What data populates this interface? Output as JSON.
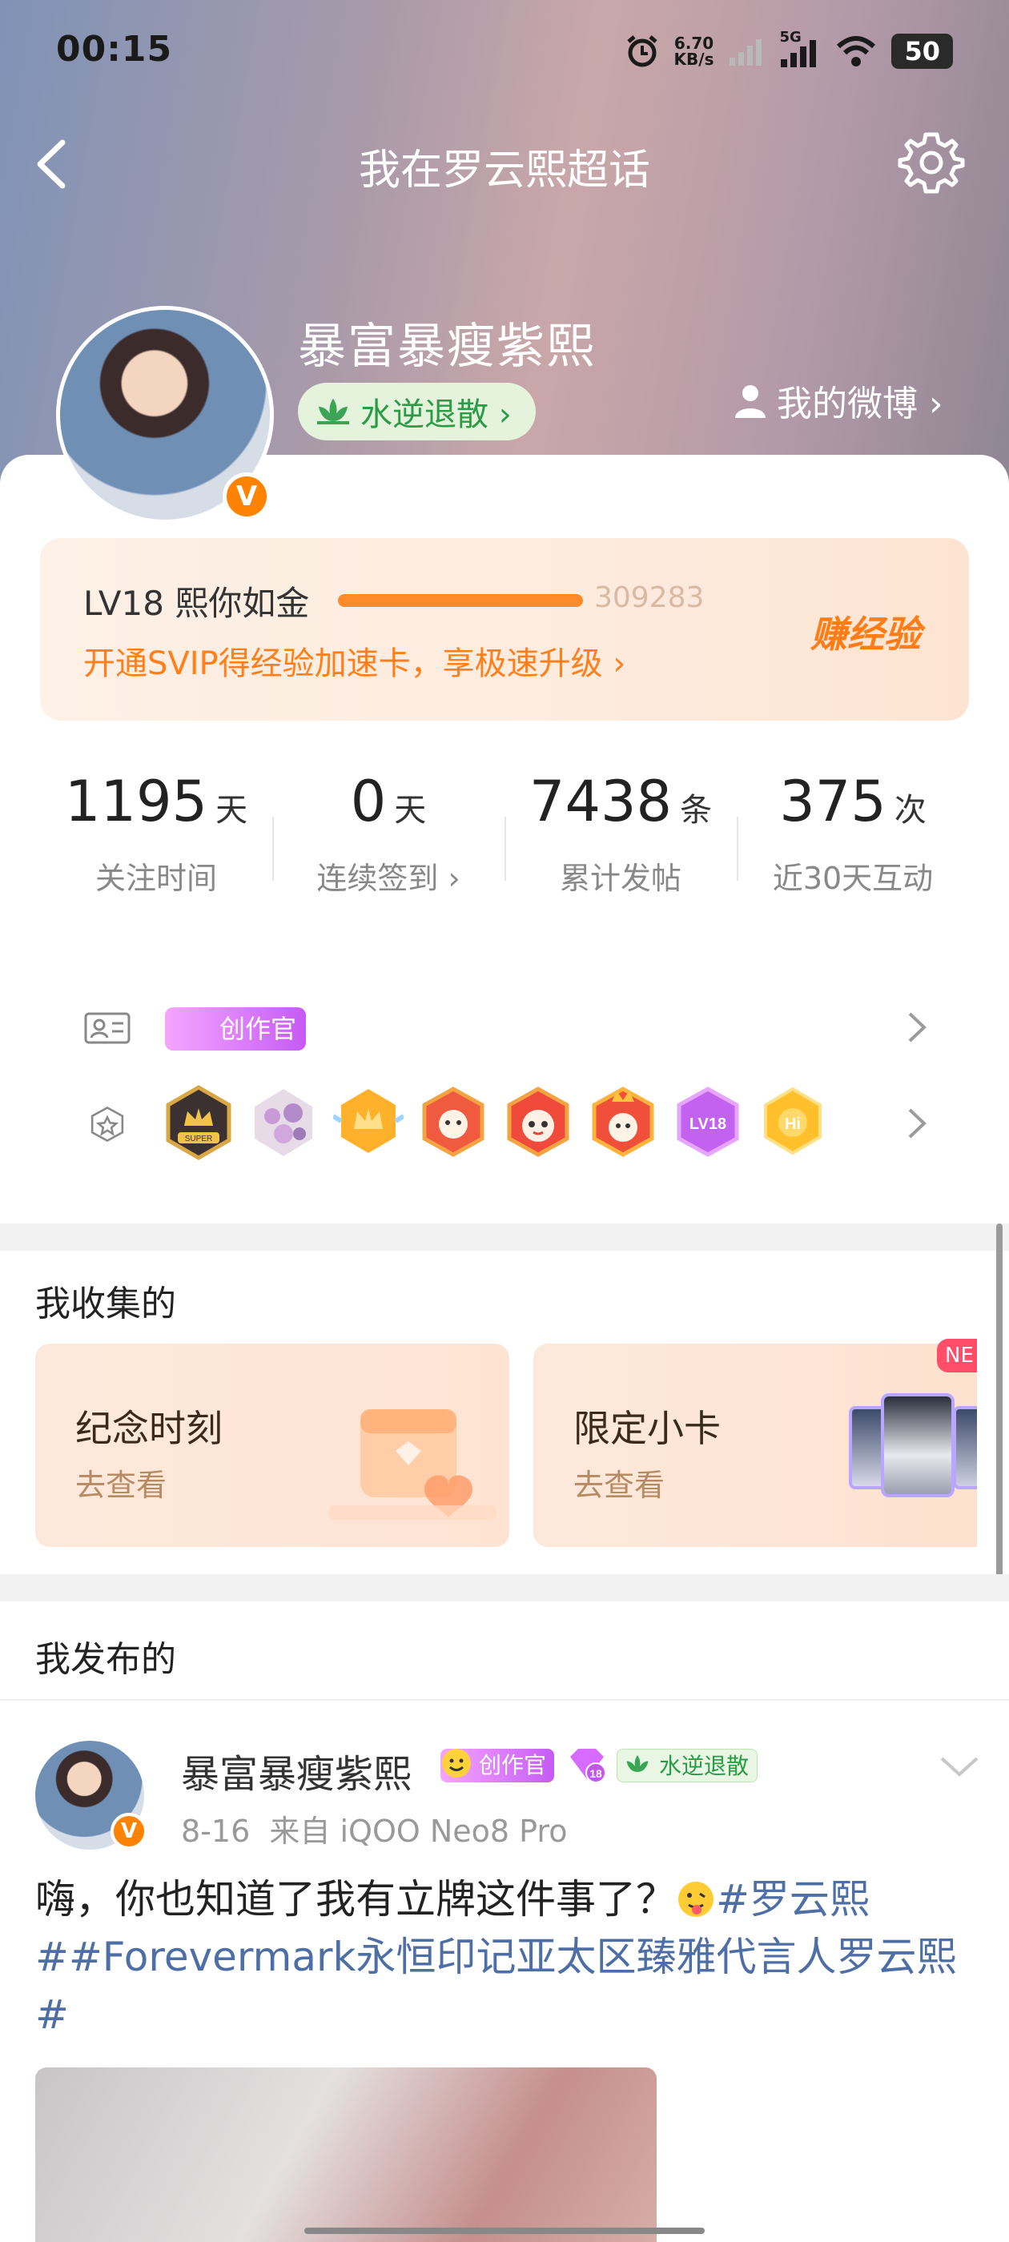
{
  "status_bar": {
    "time": "00:15",
    "net_speed_value": "6.70",
    "net_speed_unit": "KB/s",
    "network": "5G",
    "battery": "50"
  },
  "nav": {
    "title": "我在罗云熙超话",
    "back_icon": "chevron-left-icon",
    "settings_icon": "gear-icon"
  },
  "profile": {
    "username": "暴富暴瘦紫熙",
    "verified_badge": "V",
    "fan_title": "水逆退散 ›",
    "my_weibo_label": "我的微博 ›"
  },
  "level_card": {
    "level_text": "LV18 熙你如金",
    "level_progress": 1.0,
    "exp": "309283",
    "promo": "开通SVIP得经验加速卡，享极速升级 ›",
    "earn_exp_label": "赚经验"
  },
  "stats": [
    {
      "value": "1195",
      "unit": "天",
      "label": "关注时间"
    },
    {
      "value": "0",
      "unit": "天",
      "label": "连续签到 ›"
    },
    {
      "value": "7438",
      "unit": "条",
      "label": "累计发帖"
    },
    {
      "value": "375",
      "unit": "次",
      "label": "近30天互动"
    }
  ],
  "honors": {
    "creator_tag": "创作官",
    "badge_icons": [
      "super-crown-badge-icon",
      "diamond-badge-icon",
      "gold-crown-badge-icon",
      "red-fox-badge-icon",
      "red-cat-badge-icon",
      "fire-fox-badge-icon",
      "lv18-badge-icon",
      "hi-badge-icon"
    ],
    "lv_badge_text": "LV18",
    "hi_badge_text": "Hi",
    "super_badge_text": "SUPER"
  },
  "collected": {
    "title": "我收集的",
    "cards": [
      {
        "title": "纪念时刻",
        "sub": "去查看"
      },
      {
        "title": "限定小卡",
        "sub": "去查看",
        "badge": "NE"
      }
    ]
  },
  "published": {
    "title": "我发布的"
  },
  "post": {
    "author": "暴富暴瘦紫熙",
    "creator_tag": "创作官",
    "level_tag": "18",
    "fan_tag": "水逆退散",
    "date": "8-16",
    "source": "来自 iQOO Neo8 Pro",
    "text_plain": "嗨，你也知道了我有立牌这件事了？",
    "topic1": "#罗云熙",
    "topic2": "##Forevermark永恒印记亚太区臻雅代言人罗云熙#"
  },
  "colors": {
    "accent_orange": "#ff8200",
    "topic_blue": "#4e6fa6",
    "fan_green": "#2b9c46"
  }
}
